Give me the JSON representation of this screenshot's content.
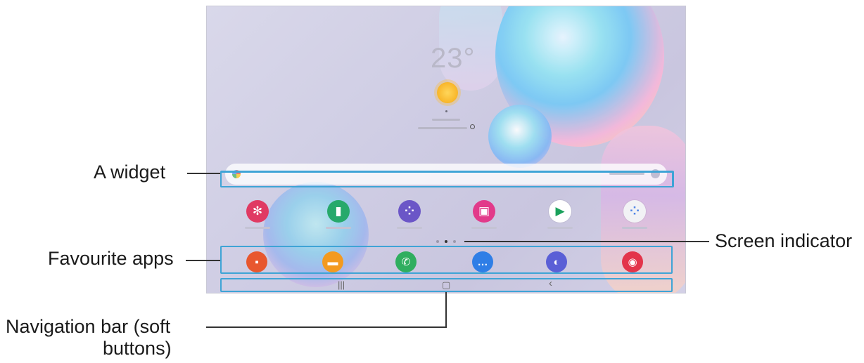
{
  "screen": {
    "weather_temp": "23°",
    "icon_labels": [
      "sun-icon"
    ]
  },
  "apps_row": [
    {
      "icon": "flower-icon",
      "color": "#e03a63",
      "glyph": "✻"
    },
    {
      "icon": "calendar-icon",
      "color": "#27a96b",
      "glyph": "▮"
    },
    {
      "icon": "galaxy-essentials-icon",
      "color": "#6b56c7",
      "glyph": "⁘"
    },
    {
      "icon": "galaxy-store-icon",
      "color": "#e23a8a",
      "glyph": "▣"
    },
    {
      "icon": "play-store-icon",
      "color": "#ffffff",
      "glyph": "▶"
    },
    {
      "icon": "app-folder-icon",
      "color": "#f2f2f5",
      "glyph": "⁘"
    }
  ],
  "dock": [
    {
      "icon": "notes-icon",
      "color": "#e8572e",
      "glyph": "▪"
    },
    {
      "icon": "my-files-icon",
      "color": "#f39a1f",
      "glyph": "▬"
    },
    {
      "icon": "phone-icon",
      "color": "#2fae5f",
      "glyph": "✆"
    },
    {
      "icon": "messages-icon",
      "color": "#2f7ee6",
      "glyph": "…"
    },
    {
      "icon": "internet-icon",
      "color": "#5a5fd6",
      "glyph": "◐"
    },
    {
      "icon": "camera-icon",
      "color": "#e3344a",
      "glyph": "◉"
    }
  ],
  "navbar": {
    "recents_glyph": "|||",
    "home_glyph": "▢",
    "back_glyph": "‹"
  },
  "callouts": {
    "widget": "A widget",
    "favourite_apps": "Favourite apps",
    "screen_indicator": "Screen indicator",
    "navigation_bar_line1": "Navigation bar (soft",
    "navigation_bar_line2": "buttons)"
  },
  "colors": {
    "highlight": "#3fa4d6",
    "callout_line": "#333333"
  }
}
